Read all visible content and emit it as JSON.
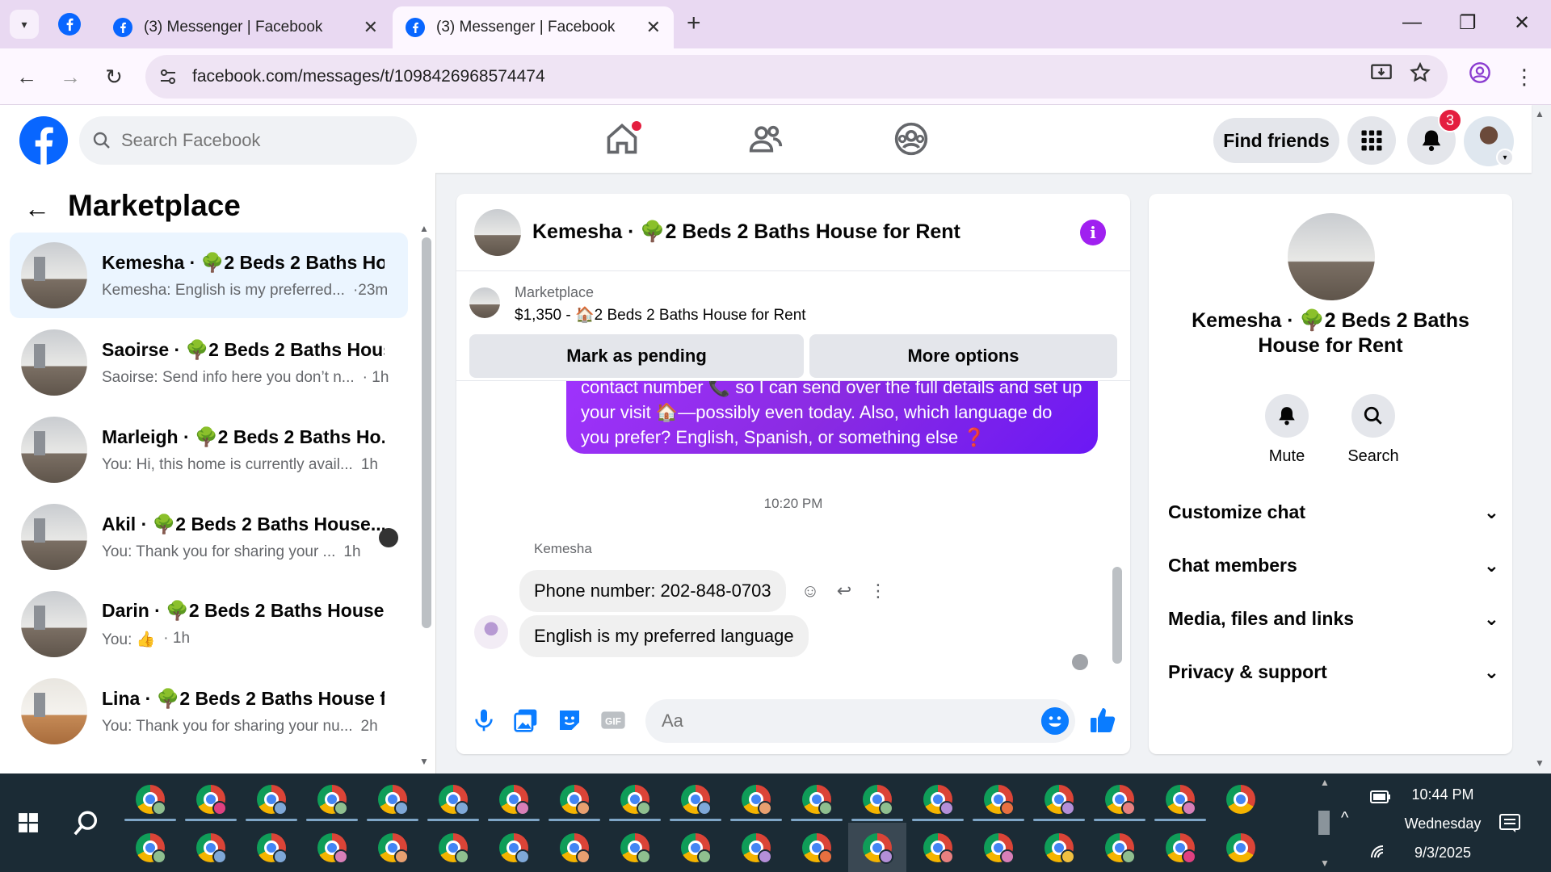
{
  "browser": {
    "tabs": [
      {
        "title": "(3) Messenger | Facebook",
        "active": false
      },
      {
        "title": "(3) Messenger | Facebook",
        "active": true
      }
    ],
    "url": "facebook.com/messages/t/1098426968574474"
  },
  "fb_header": {
    "search_placeholder": "Search Facebook",
    "find_friends_label": "Find friends",
    "notification_count": "3"
  },
  "left_panel": {
    "title": "Marketplace",
    "conversations": [
      {
        "name": "Kemesha · 🌳2 Beds 2 Baths Ho...",
        "preview": "Kemesha: English is my preferred...",
        "time": "·23m",
        "selected": true
      },
      {
        "name": "Saoirse · 🌳2 Beds 2 Baths Hous...",
        "preview": "Saoirse: Send info here you don’t n...",
        "time": "· 1h"
      },
      {
        "name": "Marleigh · 🌳2 Beds 2 Baths Ho...",
        "preview": "You: Hi, this home is currently avail...",
        "time": "1h"
      },
      {
        "name": "Akil · 🌳2 Beds 2 Baths House...",
        "preview": "You: Thank you for sharing your ...",
        "time": "1h"
      },
      {
        "name": "Darin · 🌳2 Beds 2 Baths House ...",
        "preview": "You: 👍",
        "time": "· 1h"
      },
      {
        "name": "Lina · 🌳2 Beds 2 Baths House f...",
        "preview": "You: Thank you for sharing your nu...",
        "time": "2h"
      }
    ]
  },
  "chat": {
    "title": "Kemesha · 🌳2 Beds 2 Baths House for Rent",
    "listing": {
      "source": "Marketplace",
      "price_title": "$1,350 - 🏠2 Beds 2 Baths House for Rent",
      "mark_pending_label": "Mark as pending",
      "more_options_label": "More options"
    },
    "outgoing_message": "contact number 📞 so I can send over the full details and set up your visit 🏠—possibly even today. Also, which language do you prefer? English, Spanish, or something else ❓",
    "timestamp": "10:20 PM",
    "sender_name": "Kemesha",
    "incoming_messages": [
      "Phone number: 202-848-0703",
      "English is my preferred language"
    ],
    "composer_placeholder": "Aa"
  },
  "right_panel": {
    "name": "Kemesha · 🌳2 Beds 2 Baths House for Rent",
    "mute_label": "Mute",
    "search_label": "Search",
    "sections": [
      "Customize chat",
      "Chat members",
      "Media, files and links",
      "Privacy & support"
    ]
  },
  "taskbar": {
    "time": "10:44 PM",
    "day": "Wednesday",
    "date": "9/3/2025"
  },
  "colors": {
    "fb_blue": "#0866ff",
    "messenger_purple": "#8a2be2",
    "taskbar": "#1b2b35",
    "tab_strip": "#e9d9f2"
  }
}
